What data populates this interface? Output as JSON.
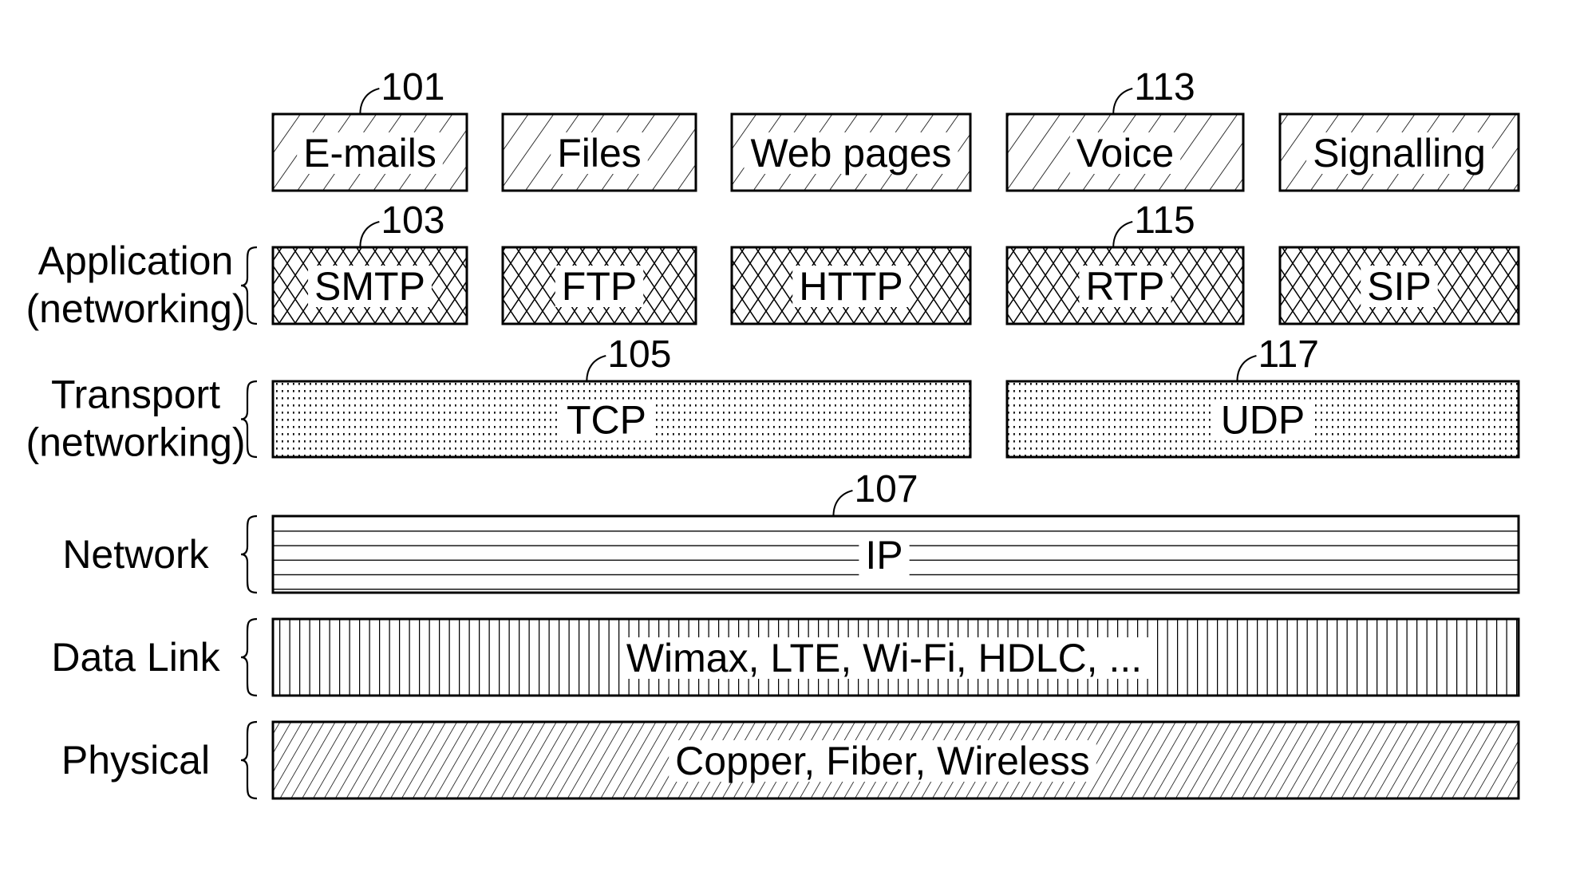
{
  "diagram": {
    "type": "protocol-stack",
    "layers": [
      {
        "id": "application",
        "label_lines": [
          "Application",
          "(networking)"
        ]
      },
      {
        "id": "transport",
        "label_lines": [
          "Transport",
          "(networking)"
        ]
      },
      {
        "id": "network",
        "label_lines": [
          "Network"
        ]
      },
      {
        "id": "datalink",
        "label_lines": [
          "Data Link"
        ]
      },
      {
        "id": "physical",
        "label_lines": [
          "Physical"
        ]
      }
    ],
    "content_row": [
      {
        "label": "E-mails",
        "ref": "101",
        "pattern": "hatch"
      },
      {
        "label": "Files",
        "ref": "",
        "pattern": "hatch"
      },
      {
        "label": "Web pages",
        "ref": "",
        "pattern": "hatch"
      },
      {
        "label": "Voice",
        "ref": "113",
        "pattern": "hatch"
      },
      {
        "label": "Signalling",
        "ref": "",
        "pattern": "hatch"
      }
    ],
    "application_row": [
      {
        "label": "SMTP",
        "ref": "103",
        "pattern": "crosshatch"
      },
      {
        "label": "FTP",
        "ref": "",
        "pattern": "crosshatch"
      },
      {
        "label": "HTTP",
        "ref": "",
        "pattern": "crosshatch"
      },
      {
        "label": "RTP",
        "ref": "115",
        "pattern": "crosshatch"
      },
      {
        "label": "SIP",
        "ref": "",
        "pattern": "crosshatch"
      }
    ],
    "transport_row": [
      {
        "label": "TCP",
        "ref": "105",
        "pattern": "dots"
      },
      {
        "label": "UDP",
        "ref": "117",
        "pattern": "dots"
      }
    ],
    "network_row": {
      "label": "IP",
      "ref": "107",
      "pattern": "horizontal-lines"
    },
    "datalink_row": {
      "label": "Wimax, LTE, Wi-Fi, HDLC, ...",
      "pattern": "vertical-lines"
    },
    "physical_row": {
      "label": "Copper, Fiber, Wireless",
      "pattern": "diagonal-dense"
    }
  }
}
